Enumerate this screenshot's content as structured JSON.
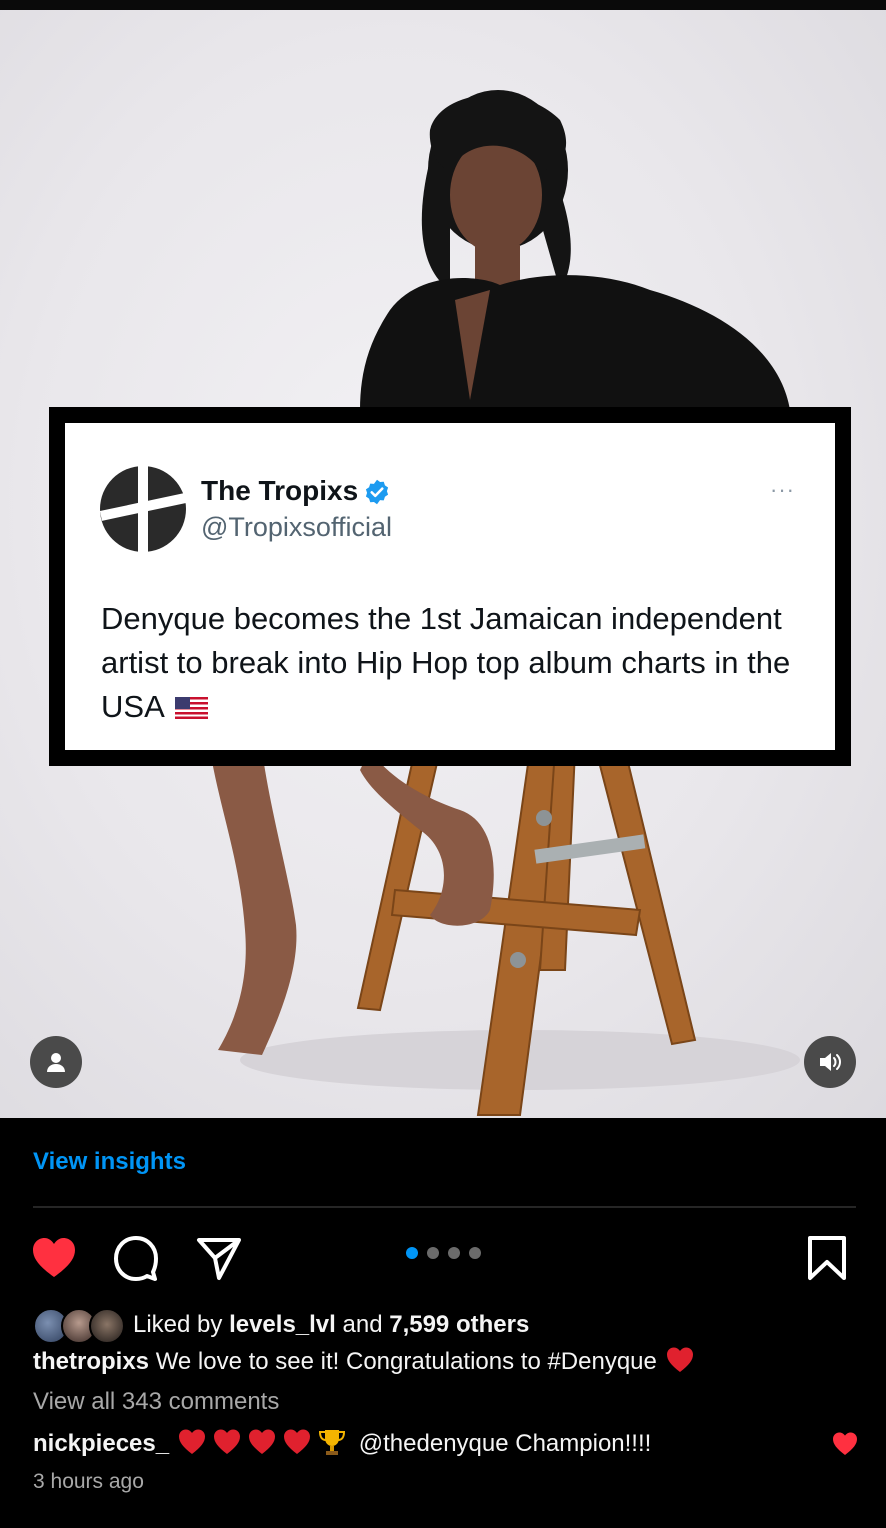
{
  "post": {
    "tweet": {
      "name": "The Tropixs",
      "handle": "@Tropixsofficial",
      "text": "Denyque becomes the 1st Jamaican independent artist to break into Hip Hop top album charts in the USA",
      "more": "···",
      "verified": true,
      "flag_icon": "us-flag-icon"
    },
    "overlays": {
      "user_tag_icon": "person-icon",
      "sound_icon": "speaker-icon"
    },
    "insights_label": "View insights",
    "actions": {
      "like_icon": "heart-filled-icon",
      "comment_icon": "comment-icon",
      "share_icon": "send-icon",
      "save_icon": "bookmark-icon",
      "carousel_total": 4,
      "carousel_index": 1
    },
    "likes": {
      "prefix": "Liked by",
      "user": "levels_lvl",
      "joiner": "and",
      "others": "7,599 others"
    },
    "caption": {
      "username": "thetropixs",
      "text": "We love to see it! Congratulations to #Denyque"
    },
    "view_comments": "View all 343 comments",
    "top_comment": {
      "username": "nickpieces_",
      "text": "@thedenyque Champion!!!!",
      "liked": true
    },
    "timestamp": "3 hours ago"
  },
  "colors": {
    "accent_blue": "#0095f6",
    "like_red": "#ff3040",
    "verified_blue": "#1d9bf0"
  }
}
